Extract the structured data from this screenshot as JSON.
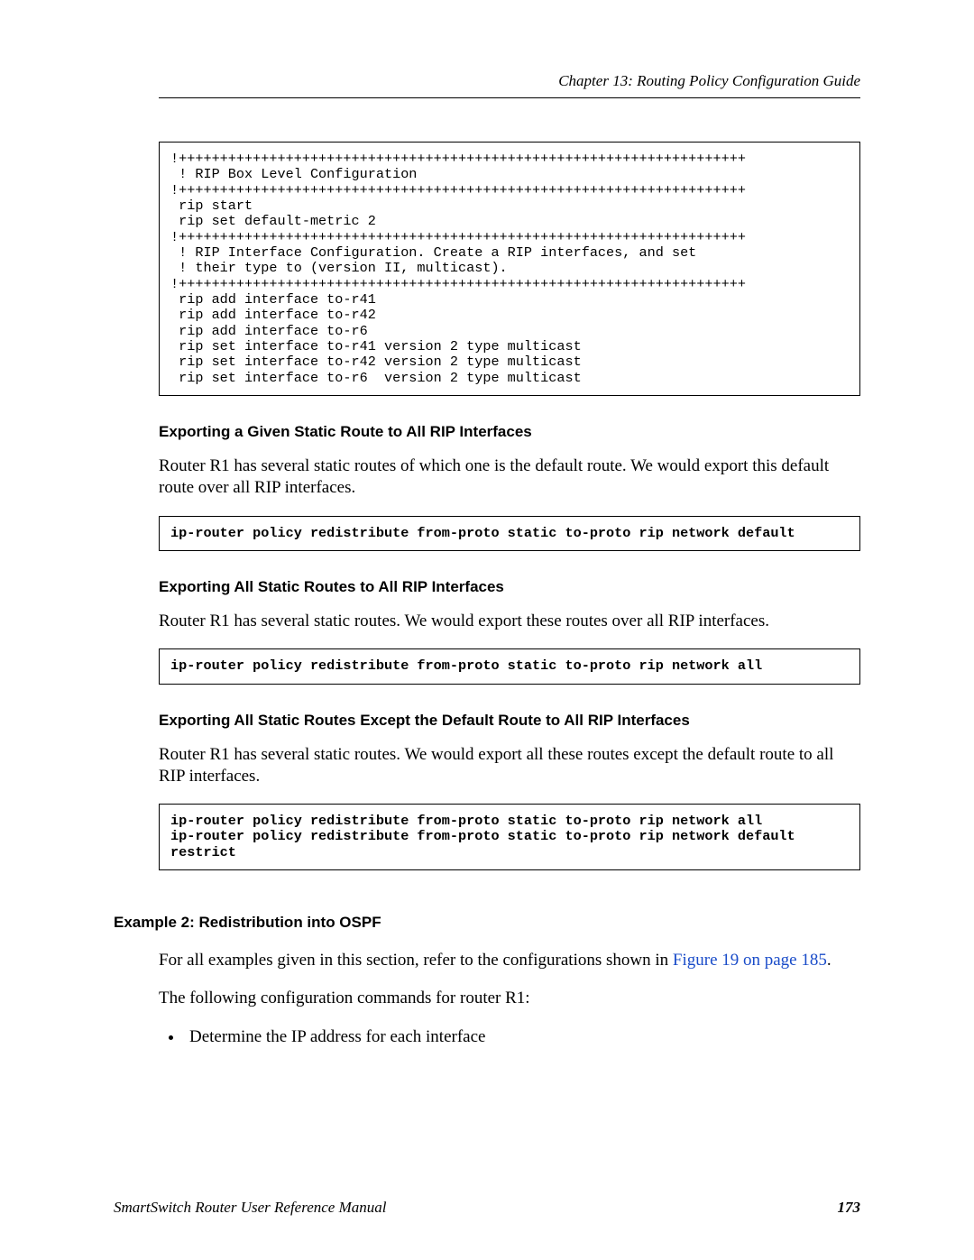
{
  "chapter": "Chapter 13: Routing Policy Configuration Guide",
  "code1": "!+++++++++++++++++++++++++++++++++++++++++++++++++++++++++++++++++++++\n ! RIP Box Level Configuration\n!+++++++++++++++++++++++++++++++++++++++++++++++++++++++++++++++++++++\n rip start\n rip set default-metric 2\n!+++++++++++++++++++++++++++++++++++++++++++++++++++++++++++++++++++++\n ! RIP Interface Configuration. Create a RIP interfaces, and set\n ! their type to (version II, multicast).\n!+++++++++++++++++++++++++++++++++++++++++++++++++++++++++++++++++++++\n rip add interface to-r41\n rip add interface to-r42\n rip add interface to-r6\n rip set interface to-r41 version 2 type multicast\n rip set interface to-r42 version 2 type multicast\n rip set interface to-r6  version 2 type multicast",
  "h1": "Exporting a Given Static Route to All RIP Interfaces",
  "p1": "Router R1 has several static routes of which one is the default route. We would export this default route over all RIP interfaces.",
  "code2": "ip-router policy redistribute from-proto static to-proto rip network default",
  "h2": "Exporting All Static Routes to All RIP Interfaces",
  "p2": "Router R1 has several static routes. We would export these routes over all RIP interfaces.",
  "code3": "ip-router policy redistribute from-proto static to-proto rip network all",
  "h3": "Exporting All Static Routes Except the Default Route to All RIP Interfaces",
  "p3": "Router R1 has several static routes. We would export all these routes except the default route to all RIP interfaces.",
  "code4": "ip-router policy redistribute from-proto static to-proto rip network all\nip-router policy redistribute from-proto static to-proto rip network default restrict",
  "example_heading": "Example 2: Redistribution into OSPF",
  "p4a": "For all examples given in this section, refer to the configurations shown in ",
  "p4b_link": "Figure 19 on page 185",
  "p4c": ".",
  "p5": "The following configuration commands for router R1:",
  "bullet1": "Determine the IP address for each interface",
  "footer_left": "SmartSwitch Router User Reference Manual",
  "footer_right": "173"
}
